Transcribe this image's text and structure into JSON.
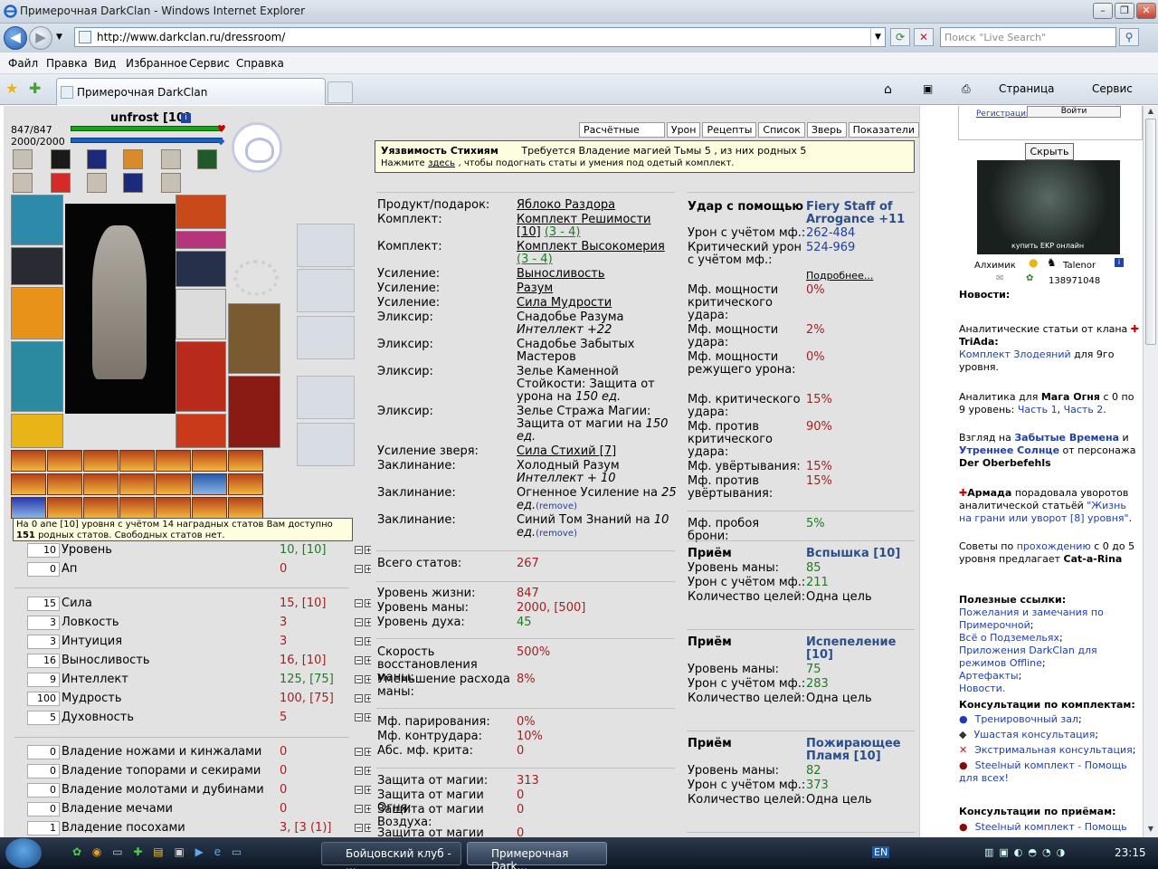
{
  "browser": {
    "window_title": "Примерочная DarkClan - Windows Internet Explorer",
    "url": "http://www.darkclan.ru/dressroom/",
    "search_placeholder": "Поиск \"Live Search\"",
    "menu": [
      "Файл",
      "Правка",
      "Вид",
      "Избранное",
      "Сервис",
      "Справка"
    ],
    "tab_title": "Примерочная DarkClan",
    "cmd_page": "Страница",
    "cmd_tools": "Сервис"
  },
  "character": {
    "name": "unfrost [10]",
    "hp_text": "847/847",
    "mana_text": "2000/2000",
    "hp_level": 1.0,
    "mana_level": 1.0
  },
  "tooltip": {
    "text1": "На 0 апе [10] уровня с учётом 14 наградных статов Вам доступно",
    "num": "151",
    "text2": "родных статов. Свободных статов нет."
  },
  "stats_group1": [
    {
      "box": "10",
      "name": "Уровень",
      "value": "10, [10]",
      "color": "green"
    },
    {
      "box": "0",
      "name": "Ап",
      "value": "0",
      "color": "red"
    }
  ],
  "stats_group2": [
    {
      "box": "15",
      "name": "Сила",
      "value": "15, [10]",
      "color": "red"
    },
    {
      "box": "3",
      "name": "Ловкость",
      "value": "3",
      "color": "red"
    },
    {
      "box": "3",
      "name": "Интуиция",
      "value": "3",
      "color": "red"
    },
    {
      "box": "16",
      "name": "Выносливость",
      "value": "16, [10]",
      "color": "red"
    },
    {
      "box": "9",
      "name": "Интеллект",
      "value": "125, [75]",
      "color": "green"
    },
    {
      "box": "100",
      "name": "Мудрость",
      "value": "100, [75]",
      "color": "red"
    },
    {
      "box": "5",
      "name": "Духовность",
      "value": "5",
      "color": "red"
    }
  ],
  "stats_group3": [
    {
      "box": "0",
      "name": "Владение ножами и кинжалами",
      "value": "0",
      "color": "red"
    },
    {
      "box": "0",
      "name": "Владение топорами и секирами",
      "value": "0",
      "color": "red"
    },
    {
      "box": "0",
      "name": "Владение молотами и дубинами",
      "value": "0",
      "color": "red"
    },
    {
      "box": "0",
      "name": "Владение мечами",
      "value": "0",
      "color": "red"
    },
    {
      "box": "1",
      "name": "Владение посохами",
      "value": "3, [3 (1)]",
      "color": "red"
    }
  ],
  "mid": {
    "tabs": [
      "Расчётные данные",
      "Урон",
      "Рецепты",
      "Список",
      "Зверь",
      "Показатели"
    ],
    "note_title": "Уязвимость Стихиям",
    "note_req": "Требуется Владение магией Тьмы 5 , из них родных 5",
    "note_line2a": "Нажмите",
    "note_here": "здесь",
    "note_line2b": ", чтобы подогнать статы и умения под одетый комплект.",
    "items": [
      {
        "label": "Продукт/подарок:",
        "value": "Яблоко Раздора"
      },
      {
        "label": "Комплект:",
        "value": "Комплект Решимости",
        "extra1": "[10]",
        "extra2": "(3 - 4)"
      },
      {
        "label": "Комплект:",
        "value": "Комплект Высокомерия",
        "extra2": "(3 - 4)"
      },
      {
        "label": "Усиление:",
        "value": "Выносливость"
      },
      {
        "label": "Усиление:",
        "value": "Разум"
      },
      {
        "label": "Усиление:",
        "value": "Сила Мудрости"
      },
      {
        "label": "Эликсир:",
        "value": "Снадобье Разума",
        "italic": "Интеллект +22"
      },
      {
        "label": "Эликсир:",
        "value": "Снадобье Забытых Мастеров"
      },
      {
        "label": "Эликсир:",
        "value": "Зелье Каменной Стойкости: Защита от урона на",
        "italic": "150 ед."
      },
      {
        "label": "Эликсир:",
        "value": "Зелье Стража Магии: Защита от магии на",
        "italic": "150 ед."
      },
      {
        "label": "Усиление зверя:",
        "value": "Сила Стихий [7]"
      },
      {
        "label": "Заклинание:",
        "value": "Холодный Разум",
        "italic": "Интеллект + 10"
      },
      {
        "label": "Заклинание:",
        "value": "Огненное Усиление на",
        "italic": "25 ед.",
        "remove": "(remove)"
      },
      {
        "label": "Заклинание:",
        "value": "Синий Том Знаний на",
        "italic": "10 ед.",
        "remove": "(remove)"
      }
    ],
    "totals": [
      {
        "label": "Всего статов:",
        "value": "267"
      },
      {
        "label": "Уровень жизни:",
        "value": "847"
      },
      {
        "label": "Уровень маны:",
        "value": "2000, [500]"
      },
      {
        "label": "Уровень духа:",
        "value": "45"
      },
      {
        "label": "Скорость восстановления маны:",
        "value": "500%"
      },
      {
        "label": "Уменьшение расхода маны:",
        "value": "8%"
      },
      {
        "label": "Мф. парирования:",
        "value": "0%"
      },
      {
        "label": "Мф. контрудара:",
        "value": "10%"
      },
      {
        "label": "Абс. мф. крита:",
        "value": "0"
      },
      {
        "label": "Защита от магии:",
        "value": "313"
      },
      {
        "label": "Защита от магии Огня:",
        "value": "0"
      },
      {
        "label": "Защита от магии Воздуха:",
        "value": "0"
      },
      {
        "label": "Защита от магии",
        "value": "0"
      }
    ],
    "attack": {
      "label": "Удар с помощью",
      "weapon": "Fiery Staff of Arrogance +11",
      "rows": [
        {
          "label": "Урон с учётом мф.:",
          "value": "262-484"
        },
        {
          "label": "Критический урон с учётом мф.:",
          "value": "524-969"
        }
      ],
      "more": "Подробнее...",
      "mods": [
        {
          "label": "Мф. мощности критического удара:",
          "value": "0%"
        },
        {
          "label": "Мф. мощности удара:",
          "value": "2%"
        },
        {
          "label": "Мф. мощности режущего урона:",
          "value": "0%"
        },
        {
          "label": "Мф. критического удара:",
          "value": "15%"
        },
        {
          "label": "Мф. против критического удара:",
          "value": "90%"
        },
        {
          "label": "Мф. увёртывания:",
          "value": "15%"
        },
        {
          "label": "Мф. против увёртывания:",
          "value": "15%"
        },
        {
          "label": "Мф. пробоя брони:",
          "value": "5%"
        }
      ]
    },
    "skills": [
      {
        "head": "Приём",
        "name": "Вспышка [10]",
        "mana": "85",
        "dmg": "211",
        "targets": "Одна цель"
      },
      {
        "head": "Приём",
        "name": "Испепеление [10]",
        "mana": "75",
        "dmg": "283",
        "targets": "Одна цель"
      },
      {
        "head": "Приём",
        "name": "Пожирающее Пламя [10]",
        "mana": "82",
        "dmg": "373",
        "targets": "Одна цель"
      }
    ],
    "skill_labels": {
      "mana": "Уровень маны:",
      "dmg": "Урон с учётом мф.:",
      "targets": "Количество целей:"
    }
  },
  "right": {
    "register": "Регистрация",
    "login": "Войти",
    "hide": "Скрыть",
    "banner": "купить EKP онлайн",
    "alchemist": "Алхимик",
    "talenor": "Talenor",
    "icq": "138971048",
    "news_title": "Новости:",
    "news1a": "Аналитические статьи от клана",
    "news1b": "TriAda:",
    "news1c": "Комплект Злодеяний",
    "news1d": "для 9го уровня.",
    "news2a": "Аналитика для",
    "news2b": "Мага Огня",
    "news2c": "с 0 по 9 уровень:",
    "news2d": "Часть 1",
    "news2e": "Часть 2",
    "news3a": "Взгляд на",
    "news3b": "Забытые Времена",
    "news3c": "и",
    "news3d": "Утреннее Солнце",
    "news3e": "от персонажа",
    "news3f": "Der Oberbefehls",
    "news4a": "Армада",
    "news4b": "порадовала уворотов аналитической статьёй",
    "news4c": "\"Жизнь на грани или уворот [8] уровня\"",
    "news5a": "Советы по",
    "news5b": "прохождению",
    "news5c": "с 0 до 5 уровня предлагает",
    "news5d": "Cat-a-Rina",
    "useful": "Полезные ссылки:",
    "links": [
      "Пожелания и замечания по Примерочной",
      "Всё о Подземельях",
      "Приложения DarkClan для режимов Offline",
      "Артефакты",
      "Новости."
    ],
    "consult": "Консультации по комплектам:",
    "consults": [
      "Тренировочный зал",
      "Ушастая консультация",
      "Экстримальная консультация",
      "Steelный комплект - Помощь для всех!"
    ],
    "consult2": "Консультации по приёмам:",
    "consults2": [
      "Steelный комплект - Помощь"
    ]
  },
  "taskbar": {
    "task1": "Бойцовский клуб - ...",
    "task2": "Примерочная Dark...",
    "lang": "EN",
    "clock": "23:15"
  }
}
